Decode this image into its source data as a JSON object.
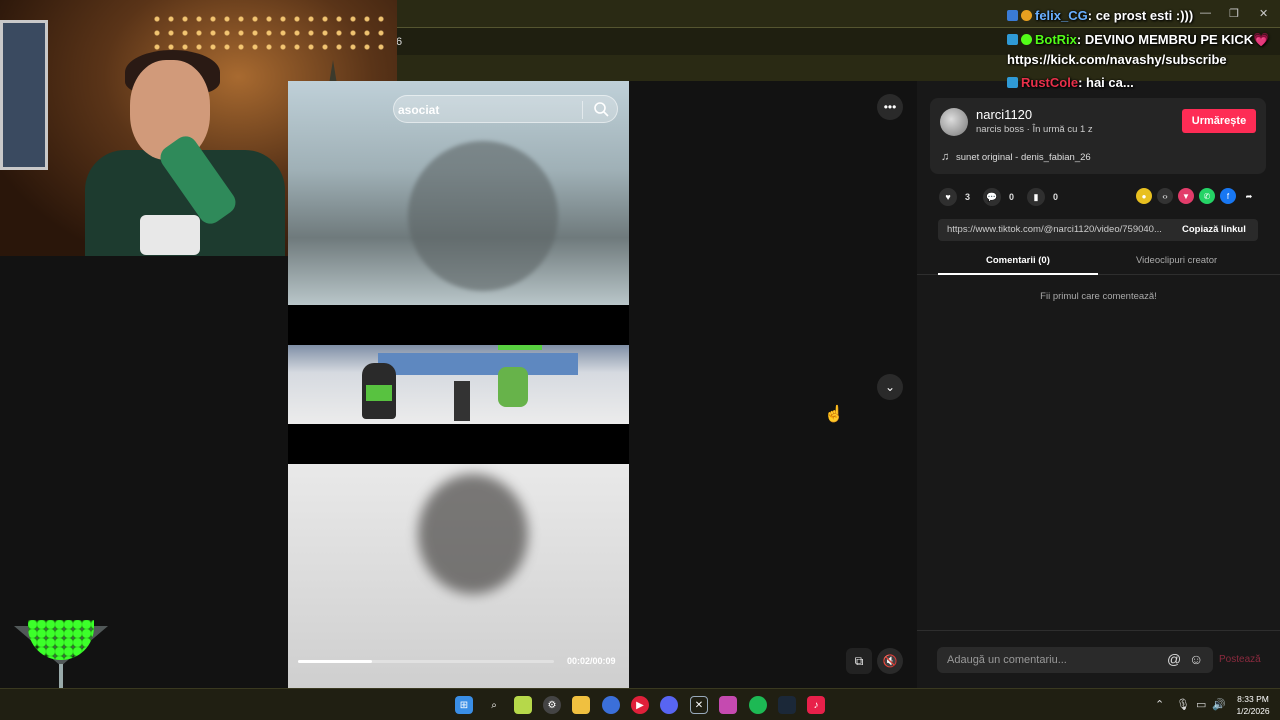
{
  "browser": {
    "address_fragment": "6",
    "window_controls": [
      "—",
      "❐",
      "✕"
    ]
  },
  "video": {
    "search_text": "asociat",
    "current_time": "00:02/00:09",
    "progress": 0.29
  },
  "author": {
    "username": "narci1120",
    "subtitle": "narcis boss · În urmă cu 1 z",
    "follow_label": "Urmărește",
    "sound": "sunet original - denis_fabian_26"
  },
  "stats": {
    "likes": "3",
    "comments": "0",
    "saves": "0"
  },
  "share_link": {
    "url": "https://www.tiktok.com/@narci1120/video/759040...",
    "copy_label": "Copiază linkul"
  },
  "tabs": {
    "comments": "Comentarii (0)",
    "creator_videos": "Videoclipuri creator"
  },
  "comments_empty": "Fii primul care comentează!",
  "comment_box": {
    "placeholder": "Adaugă un comentariu...",
    "post_label": "Postează"
  },
  "chat": [
    {
      "user": "felix_CG",
      "message": ": ce prost esti :)))",
      "color": "#6ab0ff"
    },
    {
      "user": "BotRix",
      "message": ": DEVINO MEMBRU PE KICK💗",
      "color": "#53fc18"
    },
    {
      "user": "",
      "message": "https://kick.com/navashy/subscribe",
      "color": "#ffffff"
    },
    {
      "user": "RustCole",
      "message": ": hai ca...",
      "color": "#e8304a"
    }
  ],
  "clock": {
    "time": "8:33 PM",
    "date": "1/2/2026"
  },
  "taskbar_icons": [
    "windows-start-icon",
    "search-icon",
    "notes-icon",
    "settings-icon",
    "file-explorer-icon",
    "chrome-icon",
    "youtube-icon",
    "discord-icon",
    "xbox-icon",
    "game-icon",
    "spotify-icon",
    "steam-icon",
    "tiktok-icon"
  ],
  "colors": {
    "accent": "#fe2c55",
    "panel": "#181818"
  }
}
